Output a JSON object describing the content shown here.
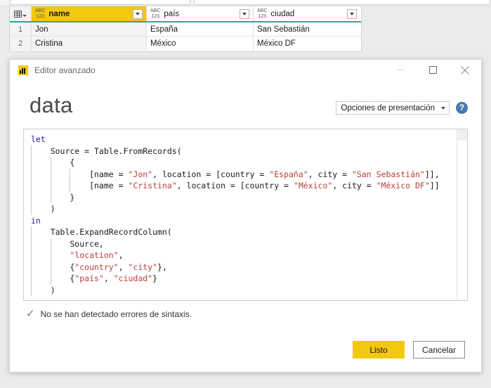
{
  "background_grid": {
    "corner_icon": "table-grid-icon",
    "columns": [
      {
        "type_icon": "abc123-text-type-icon",
        "name": "name",
        "selected": true,
        "dropdown_icon": "chevron-down-icon"
      },
      {
        "type_icon": "abc123-text-type-icon",
        "name": "país",
        "selected": false,
        "dropdown_icon": "chevron-down-icon"
      },
      {
        "type_icon": "abc123-text-type-icon",
        "name": "ciudad",
        "selected": false,
        "dropdown_icon": "chevron-down-icon"
      }
    ],
    "type_icon_top": "ABC",
    "type_icon_bottom": "123",
    "rows": [
      {
        "num": "1",
        "name": "Jon",
        "pais": "España",
        "ciudad": "San Sebastián"
      },
      {
        "num": "2",
        "name": "Cristina",
        "pais": "México",
        "ciudad": "México DF"
      }
    ],
    "selected_column_color": "#f2c811",
    "header_underline_color": "#1eaca4"
  },
  "dialog": {
    "title": "Editor avanzado",
    "app_icon": "power-bi-icon",
    "window_controls": {
      "minimize": "minimize-icon",
      "maximize": "maximize-icon",
      "close": "close-icon"
    },
    "query_name": "data",
    "display_options_label": "Opciones de presentación",
    "help_label": "?",
    "code": {
      "lines": [
        {
          "indent": 0,
          "tokens": [
            {
              "t": "let",
              "c": "kw"
            }
          ]
        },
        {
          "indent": 1,
          "tokens": [
            {
              "t": "Source = Table.FromRecords(",
              "c": ""
            }
          ]
        },
        {
          "indent": 2,
          "tokens": [
            {
              "t": "{",
              "c": ""
            }
          ]
        },
        {
          "indent": 3,
          "tokens": [
            {
              "t": "[name = ",
              "c": ""
            },
            {
              "t": "\"Jon\"",
              "c": "str"
            },
            {
              "t": ", location = [country = ",
              "c": ""
            },
            {
              "t": "\"España\"",
              "c": "str"
            },
            {
              "t": ", city = ",
              "c": ""
            },
            {
              "t": "\"San Sebastián\"",
              "c": "str"
            },
            {
              "t": "]],",
              "c": ""
            }
          ]
        },
        {
          "indent": 3,
          "tokens": [
            {
              "t": "[name = ",
              "c": ""
            },
            {
              "t": "\"Cristina\"",
              "c": "str"
            },
            {
              "t": ", location = [country = ",
              "c": ""
            },
            {
              "t": "\"México\"",
              "c": "str"
            },
            {
              "t": ", city = ",
              "c": ""
            },
            {
              "t": "\"México DF\"",
              "c": "str"
            },
            {
              "t": "]]",
              "c": ""
            }
          ]
        },
        {
          "indent": 2,
          "tokens": [
            {
              "t": "}",
              "c": ""
            }
          ]
        },
        {
          "indent": 1,
          "tokens": [
            {
              "t": ")",
              "c": ""
            }
          ]
        },
        {
          "indent": 0,
          "tokens": [
            {
              "t": "in",
              "c": "kw"
            }
          ]
        },
        {
          "indent": 1,
          "tokens": [
            {
              "t": "Table.ExpandRecordColumn(",
              "c": ""
            }
          ]
        },
        {
          "indent": 2,
          "tokens": [
            {
              "t": "Source,",
              "c": ""
            }
          ]
        },
        {
          "indent": 2,
          "tokens": [
            {
              "t": "\"location\"",
              "c": "str"
            },
            {
              "t": ",",
              "c": ""
            }
          ]
        },
        {
          "indent": 2,
          "tokens": [
            {
              "t": "{",
              "c": ""
            },
            {
              "t": "\"country\"",
              "c": "str"
            },
            {
              "t": ", ",
              "c": ""
            },
            {
              "t": "\"city\"",
              "c": "str"
            },
            {
              "t": "},",
              "c": ""
            }
          ]
        },
        {
          "indent": 2,
          "tokens": [
            {
              "t": "{",
              "c": ""
            },
            {
              "t": "\"país\"",
              "c": "str"
            },
            {
              "t": ", ",
              "c": ""
            },
            {
              "t": "\"ciudad\"",
              "c": "str"
            },
            {
              "t": "}",
              "c": ""
            }
          ]
        },
        {
          "indent": 1,
          "tokens": [
            {
              "t": ")",
              "c": ""
            }
          ]
        }
      ]
    },
    "status": {
      "icon": "check-mark-icon",
      "text": "No se han detectado errores de sintaxis.",
      "color": "#4e9a4e"
    },
    "buttons": {
      "primary": "Listo",
      "secondary": "Cancelar",
      "primary_color": "#f2c811"
    }
  }
}
